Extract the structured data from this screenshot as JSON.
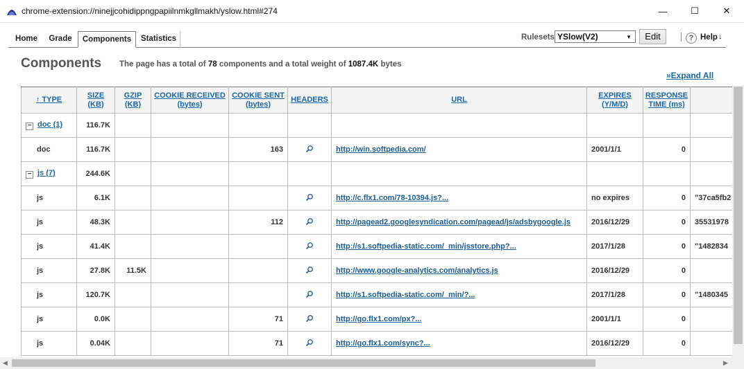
{
  "window": {
    "title": "chrome-extension://ninejjcohidippngpapiilnmkgllmakh/yslow.html#274",
    "min_glyph": "—",
    "max_glyph": "☐",
    "close_glyph": "✕"
  },
  "tabs": [
    {
      "label": "Home"
    },
    {
      "label": "Grade"
    },
    {
      "label": "Components",
      "active": true
    },
    {
      "label": "Statistics"
    }
  ],
  "toolbar": {
    "rulesets_label": "Rulesets",
    "rulesets_value": "YSlow(V2)",
    "edit_label": "Edit",
    "help_icon": "?",
    "help_label": "Help",
    "help_arrow": "↓"
  },
  "page": {
    "heading": "Components",
    "summary_prefix": "The page has a total of",
    "total_components": "78",
    "summary_mid": "components and a total weight of",
    "total_weight": "1087.4K",
    "summary_suffix": "bytes",
    "expand_all": "»Expand All"
  },
  "table": {
    "headers": {
      "type": "↑ TYPE",
      "size_1": "SIZE",
      "size_2": "(KB)",
      "gzip_1": "GZIP",
      "gzip_2": "(KB)",
      "cookie_recv_1": "COOKIE RECEIVED",
      "cookie_recv_2": "(bytes)",
      "cookie_sent_1": "COOKIE SENT",
      "cookie_sent_2": "(bytes)",
      "headers": "HEADERS",
      "url": "URL",
      "expires_1": "EXPIRES",
      "expires_2": "(Y/M/D)",
      "resp_1": "RESPONSE",
      "resp_2": "TIME (ms)"
    },
    "groups": [
      {
        "label": "doc (1)",
        "size": "116.7K",
        "rows": [
          {
            "type": "doc",
            "size": "116.7K",
            "gzip": "",
            "cookie_recv": "",
            "cookie_sent": "163",
            "url": "http://win.softpedia.com/",
            "expires": "2001/1/1",
            "response": "0",
            "etag": ""
          }
        ]
      },
      {
        "label": "js (7)",
        "size": "244.6K",
        "rows": [
          {
            "type": "js",
            "size": "6.1K",
            "gzip": "",
            "cookie_recv": "",
            "cookie_sent": "",
            "url": "http://c.flx1.com/78-10394.js?...",
            "expires": "no expires",
            "response": "0",
            "etag": "\"37ca5fb2"
          },
          {
            "type": "js",
            "size": "48.3K",
            "gzip": "",
            "cookie_recv": "",
            "cookie_sent": "112",
            "url": "http://pagead2.googlesyndication.com/pagead/js/adsbygoogle.js",
            "expires": "2016/12/29",
            "response": "0",
            "etag": "35531978"
          },
          {
            "type": "js",
            "size": "41.4K",
            "gzip": "",
            "cookie_recv": "",
            "cookie_sent": "",
            "url": "http://s1.softpedia-static.com/_min/jsstore.php?...",
            "expires": "2017/1/28",
            "response": "0",
            "etag": "\"1482834"
          },
          {
            "type": "js",
            "size": "27.8K",
            "gzip": "11.5K",
            "cookie_recv": "",
            "cookie_sent": "",
            "url": "http://www.google-analytics.com/analytics.js",
            "expires": "2016/12/29",
            "response": "0",
            "etag": ""
          },
          {
            "type": "js",
            "size": "120.7K",
            "gzip": "",
            "cookie_recv": "",
            "cookie_sent": "",
            "url": "http://s1.softpedia-static.com/_min/?...",
            "expires": "2017/1/28",
            "response": "0",
            "etag": "\"1480345"
          },
          {
            "type": "js",
            "size": "0.0K",
            "gzip": "",
            "cookie_recv": "",
            "cookie_sent": "71",
            "url": "http://go.flx1.com/px?...",
            "expires": "2001/1/1",
            "response": "0",
            "etag": ""
          },
          {
            "type": "js",
            "size": "0.04K",
            "gzip": "",
            "cookie_recv": "",
            "cookie_sent": "71",
            "url": "http://go.flx1.com/sync?...",
            "expires": "2016/12/29",
            "response": "0",
            "etag": ""
          }
        ]
      }
    ],
    "headers_icon": "magnifier-icon",
    "collapse_glyph": "−"
  },
  "colors": {
    "link": "#1a66a6",
    "header_bg": "#f4f4f4",
    "grid_border": "#b9b9b9"
  }
}
